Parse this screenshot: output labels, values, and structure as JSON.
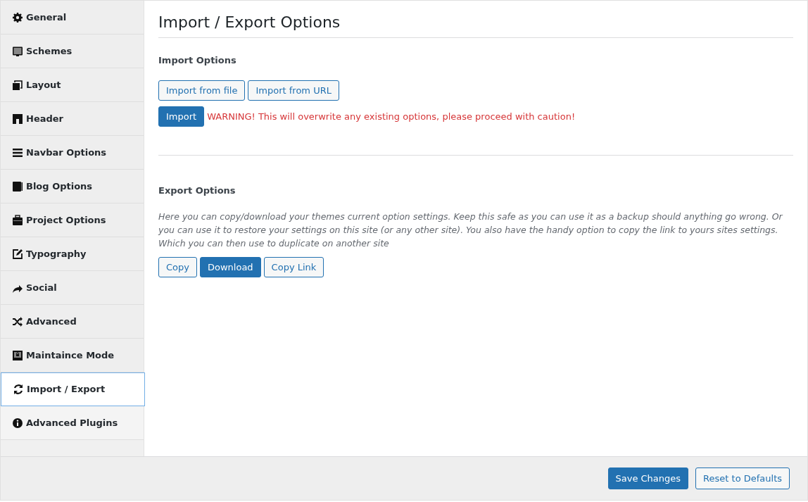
{
  "sidebar": {
    "items": [
      {
        "label": "General",
        "selected": false
      },
      {
        "label": "Schemes",
        "selected": false
      },
      {
        "label": "Layout",
        "selected": false
      },
      {
        "label": "Header",
        "selected": false
      },
      {
        "label": "Navbar Options",
        "selected": false
      },
      {
        "label": "Blog Options",
        "selected": false
      },
      {
        "label": "Project Options",
        "selected": false
      },
      {
        "label": "Typography",
        "selected": false
      },
      {
        "label": "Social",
        "selected": false
      },
      {
        "label": "Advanced",
        "selected": false
      },
      {
        "label": "Maintaince Mode",
        "selected": false
      },
      {
        "label": "Import / Export",
        "selected": true
      },
      {
        "label": "Advanced Plugins",
        "selected": false
      }
    ]
  },
  "page": {
    "title": "Import / Export Options",
    "import": {
      "heading": "Import Options",
      "buttons": [
        {
          "label": "Import from file",
          "kind": "secondary"
        },
        {
          "label": "Import from URL",
          "kind": "secondary"
        }
      ],
      "action": {
        "label": "Import",
        "kind": "primary"
      },
      "warning": "WARNING! This will overwrite any existing options, please proceed with caution!"
    },
    "export": {
      "heading": "Export Options",
      "description": "Here you can copy/download your themes current option settings. Keep this safe as you can use it as a backup should anything go wrong. Or you can use it to restore your settings on this site (or any other site). You also have the handy option to copy the link to yours sites settings. Which you can then use to duplicate on another site",
      "buttons": [
        {
          "label": "Copy",
          "kind": "secondary"
        },
        {
          "label": "Download",
          "kind": "primary"
        },
        {
          "label": "Copy Link",
          "kind": "secondary"
        }
      ]
    }
  },
  "footer": {
    "buttons": [
      {
        "label": "Save Changes",
        "kind": "primary"
      },
      {
        "label": "Reset to Defaults",
        "kind": "secondary"
      }
    ]
  }
}
